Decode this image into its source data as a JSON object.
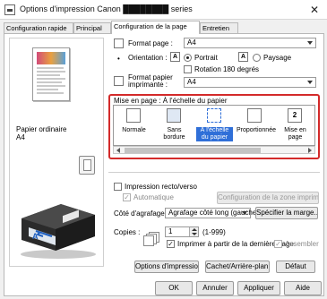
{
  "window": {
    "title": "Options d'impression Canon ████████ series",
    "close": "✕"
  },
  "tabs": [
    {
      "label": "Configuration rapide"
    },
    {
      "label": "Principal"
    },
    {
      "label": "Configuration de la page"
    },
    {
      "label": "Entretien"
    }
  ],
  "preview": {
    "media_label": "Papier ordinaire",
    "size_label": "A4"
  },
  "page_format": {
    "label": "Format page :",
    "value": "A4"
  },
  "orientation": {
    "label": "Orientation :",
    "portrait": "Portrait",
    "landscape": "Paysage",
    "portrait_glyph": "A",
    "landscape_glyph": "A",
    "rotate180": "Rotation 180 degrés"
  },
  "paper_size": {
    "label1": "Format papier",
    "label2": "imprimante :",
    "value": "A4"
  },
  "layout": {
    "label": "Mise en page :",
    "current": "À l'échelle du papier",
    "items": [
      {
        "label": "Normale"
      },
      {
        "label": "Sans bordure"
      },
      {
        "label": "À l'échelle du papier"
      },
      {
        "label": "Proportionnée"
      },
      {
        "label": "Mise en page",
        "glyph": "2"
      }
    ]
  },
  "duplex": {
    "label": "Impression recto/verso",
    "auto": "Automatique",
    "config_btn": "Configuration de la zone imprimable..."
  },
  "stapling": {
    "label": "Côté d'agrafage :",
    "value": "Agrafage côté long (gauche)",
    "margin_btn": "Spécifier la marge..."
  },
  "copies": {
    "label": "Copies :",
    "value": "1",
    "range": "(1-999)",
    "last_page": "Imprimer à partir de la dernière page",
    "collate": "Assembler"
  },
  "bottom_buttons": {
    "print_options": "Options d'impression...",
    "stamp_bg": "Cachet/Arrière-plan...",
    "default": "Défaut"
  },
  "footer": {
    "ok": "OK",
    "cancel": "Annuler",
    "apply": "Appliquer",
    "help": "Aide"
  },
  "colors": {
    "accent": "#2f6fd8",
    "highlight_border": "#d32a2a"
  }
}
